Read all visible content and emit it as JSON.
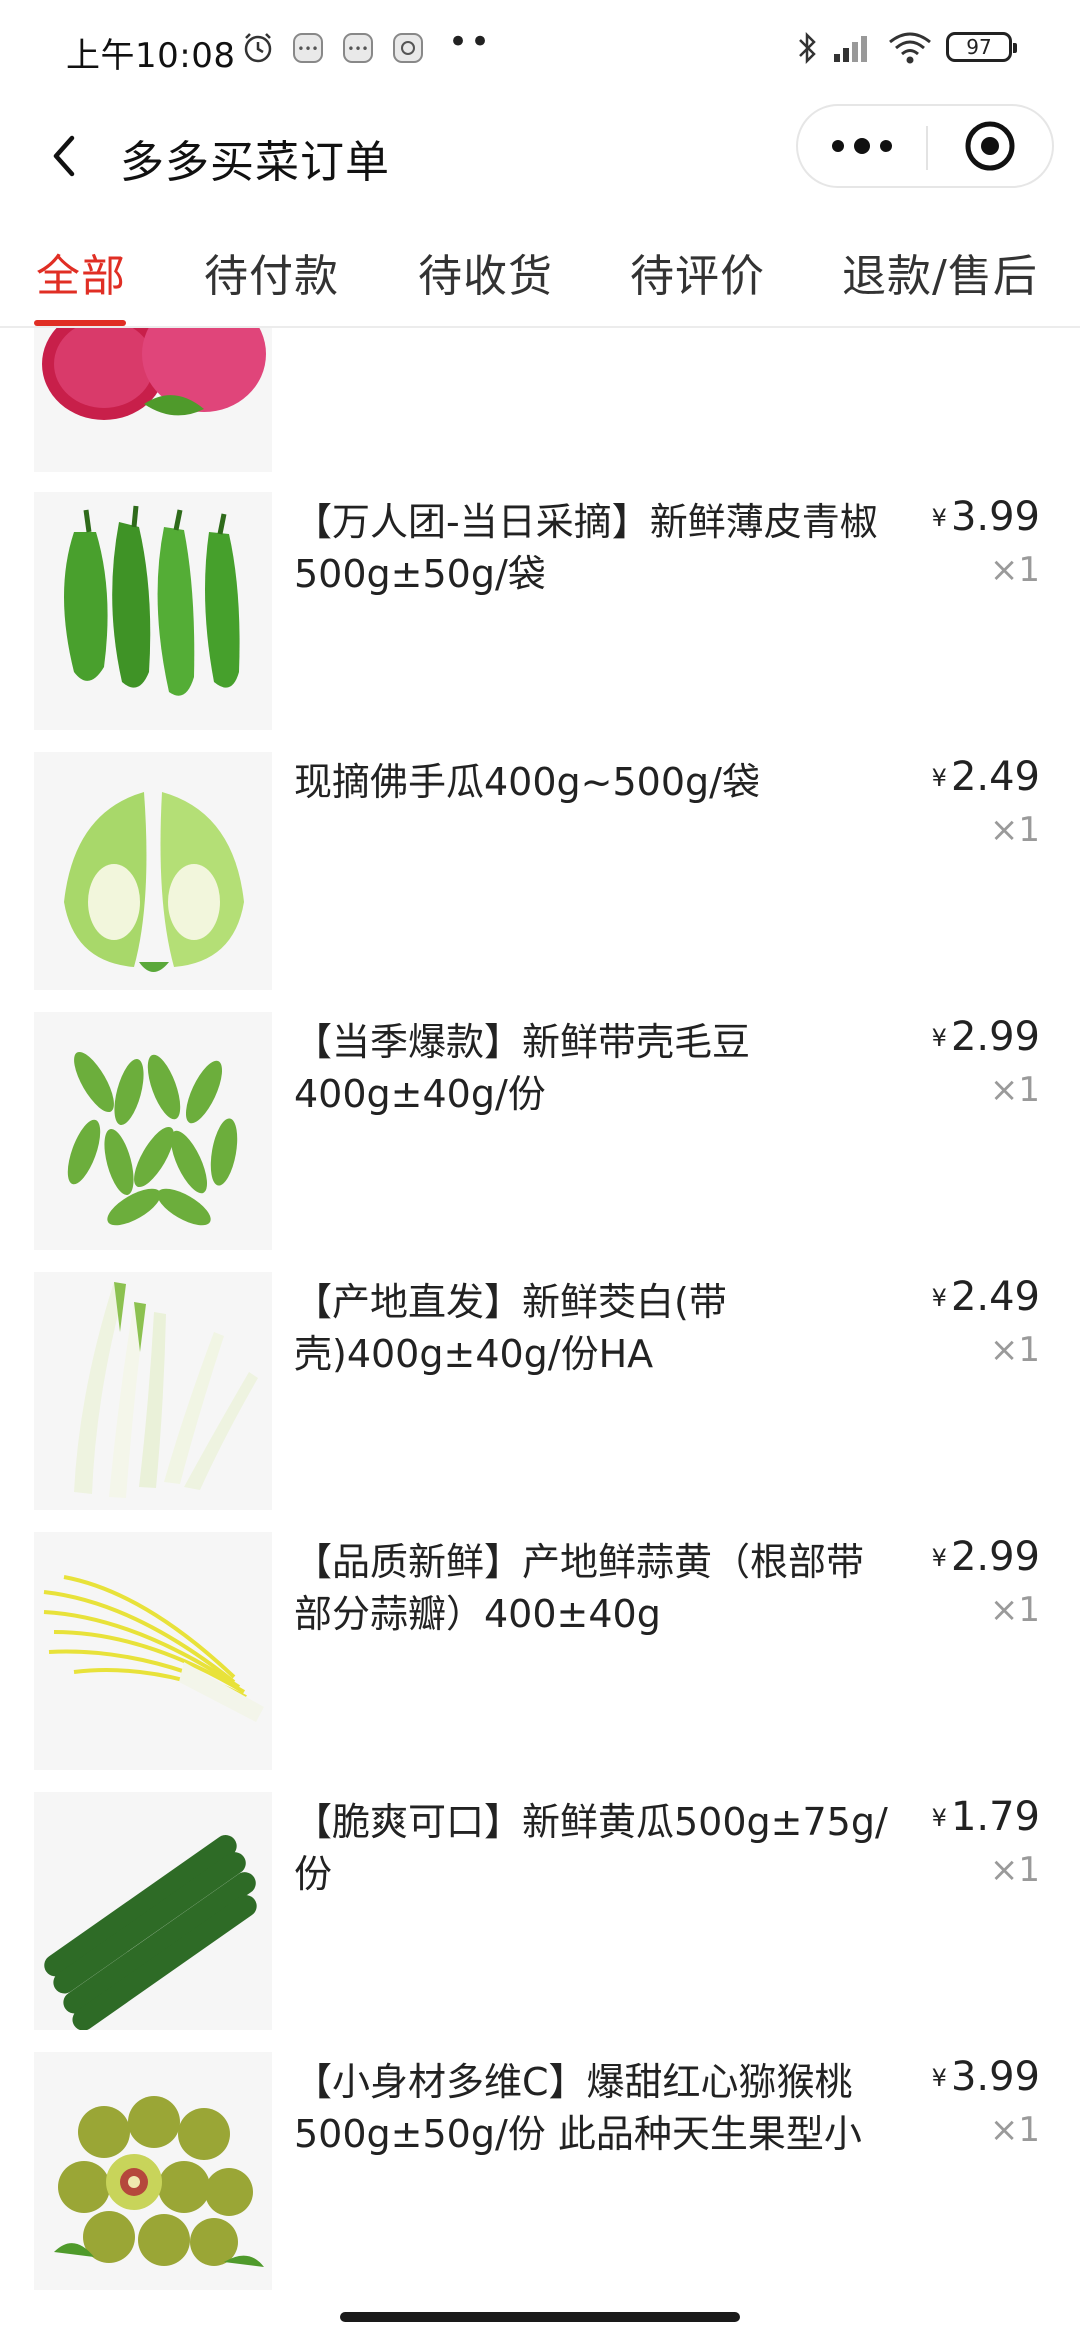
{
  "status_bar": {
    "time": "上午10:08",
    "dots": "••",
    "battery": "97",
    "icons": [
      "alarm-icon",
      "app-notification-icon",
      "app-notification-icon",
      "app-notification-icon",
      "bluetooth-icon",
      "signal-icon",
      "wifi-icon",
      "battery-icon"
    ]
  },
  "header": {
    "title": "多多买菜订单",
    "icons": [
      "back-arrow-icon",
      "more-dots-icon",
      "close-target-icon"
    ]
  },
  "tabs": [
    {
      "label": "全部",
      "active": true
    },
    {
      "label": "待付款",
      "active": false
    },
    {
      "label": "待收货",
      "active": false
    },
    {
      "label": "待评价",
      "active": false
    },
    {
      "label": "退款/售后",
      "active": false
    }
  ],
  "items": [
    {
      "name": "【万人团-当日采摘】新鲜薄皮青椒500g±50g/袋",
      "currency": "¥",
      "price": "3.99",
      "qty": "×1"
    },
    {
      "name": "现摘佛手瓜400g~500g/袋",
      "currency": "¥",
      "price": "2.49",
      "qty": "×1"
    },
    {
      "name": "【当季爆款】新鲜带壳毛豆400g±40g/份",
      "currency": "¥",
      "price": "2.99",
      "qty": "×1"
    },
    {
      "name": "【产地直发】新鲜茭白(带壳)400g±40g/份HA",
      "currency": "¥",
      "price": "2.49",
      "qty": "×1"
    },
    {
      "name": "【品质新鲜】产地鲜蒜黄（根部带部分蒜瓣）400±40g",
      "currency": "¥",
      "price": "2.99",
      "qty": "×1"
    },
    {
      "name": "【脆爽可口】新鲜黄瓜500g±75g/份",
      "currency": "¥",
      "price": "1.79",
      "qty": "×1"
    },
    {
      "name": "【小身材多维C】爆甜红心猕猴桃500g±50g/份 此品种天生果型小",
      "currency": "¥",
      "price": "3.99",
      "qty": "×1"
    }
  ],
  "colors": {
    "accent": "#e02e24",
    "text": "#222222",
    "muted": "#9a9a9a"
  }
}
